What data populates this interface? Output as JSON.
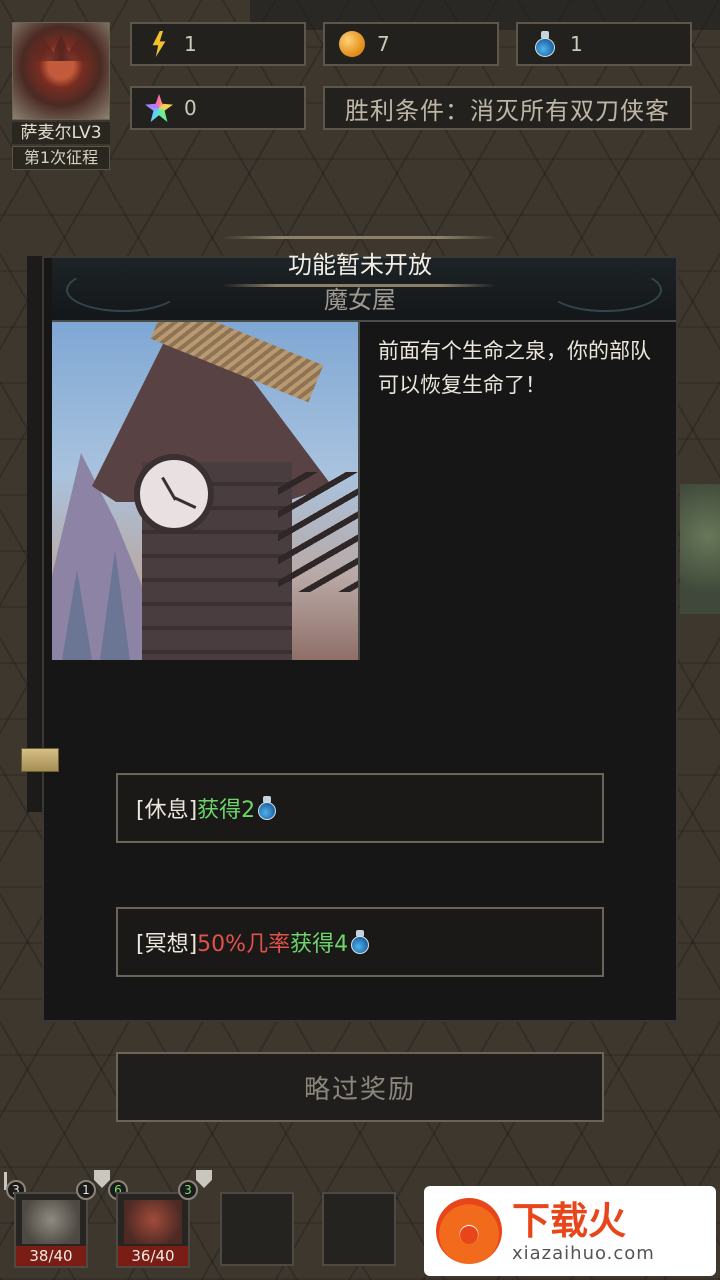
{
  "hero": {
    "name": "萨麦尔LV3",
    "expedition": "第1次征程"
  },
  "stats": {
    "energy": "1",
    "gold": "7",
    "potion": "1",
    "crystal": "0",
    "victory_condition": "胜利条件：消灭所有双刀侠客"
  },
  "notice": "功能暂未开放",
  "event": {
    "title": "魔女屋",
    "description": "前面有个生命之泉，你的部队可以恢复生命了！",
    "choices": [
      {
        "tag": "[休息]",
        "highlight": "",
        "reward": "获得2"
      },
      {
        "tag": "[冥想]",
        "highlight": "50%几率",
        "reward": "获得4"
      }
    ],
    "skip_label": "略过奖励"
  },
  "units": [
    {
      "hp": "38/40",
      "badge_left": "3",
      "badge_right": "1"
    },
    {
      "hp": "36/40",
      "badge_left": "6",
      "badge_right": "3"
    }
  ],
  "watermark": {
    "main": "下载火",
    "sub": "xiazaihuo.com"
  },
  "icons": [
    "energy-icon",
    "coin-icon",
    "potion-icon",
    "crystal-icon",
    "sword-icon",
    "shield-icon"
  ]
}
